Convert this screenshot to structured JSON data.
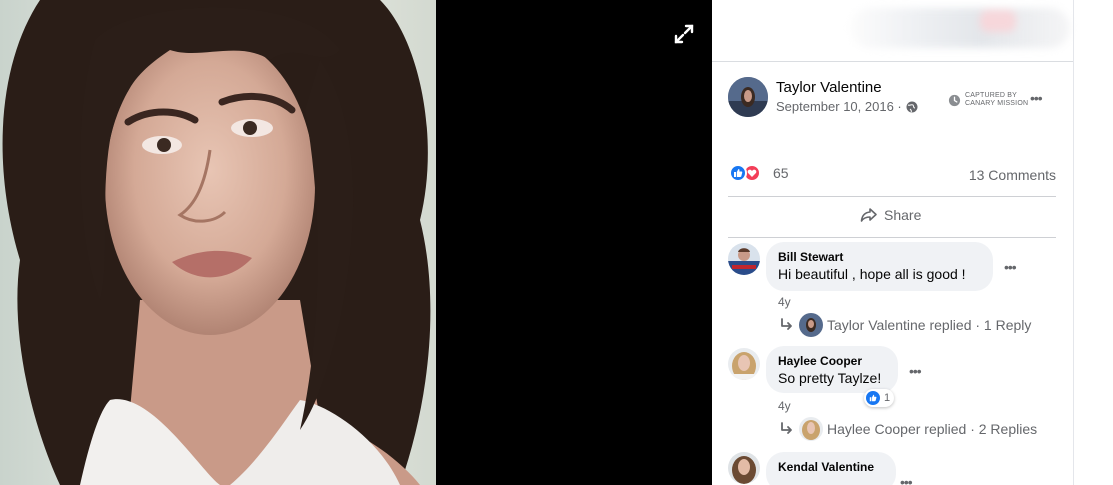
{
  "post": {
    "author": "Taylor Valentine",
    "date": "September 10, 2016 ·",
    "captured_line1": "CAPTURED BY",
    "captured_line2": "CANARY MISSION",
    "reaction_count": "65",
    "comments_count": "13 Comments",
    "share_label": "Share"
  },
  "comments": [
    {
      "name": "Bill Stewart",
      "text": "Hi beautiful , hope all is good !",
      "time": "4y",
      "reply_summary": "Taylor Valentine replied · 1 Reply"
    },
    {
      "name": "Haylee Cooper",
      "text": "So pretty Taylze!",
      "time": "4y",
      "like_count": "1",
      "reply_summary": "Haylee Cooper replied · 2 Replies"
    },
    {
      "name": "Kendal Valentine"
    }
  ],
  "icons": {
    "expand": "expand-icon",
    "globe": "globe-icon",
    "clock": "clock-icon",
    "like": "like-icon",
    "love": "love-icon",
    "share": "share-icon",
    "reply": "reply-arrow-icon",
    "more": "more-icon"
  },
  "colors": {
    "accent": "#1877f2",
    "love": "#f33e58",
    "bubble": "#f0f2f5",
    "secondary_text": "#65676b"
  }
}
